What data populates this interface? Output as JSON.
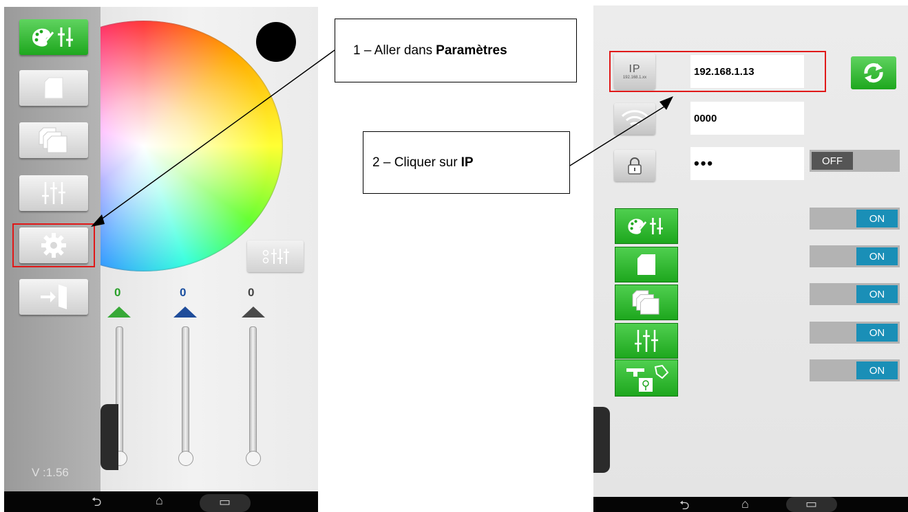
{
  "left_screen": {
    "version": "V :1.56",
    "values": [
      "0",
      "0",
      "0"
    ],
    "value_colors": [
      "#2aa02a",
      "#1a4fa0",
      "#444444"
    ],
    "sidebar_icons": [
      "palette-sliders-icon",
      "single-page-icon",
      "multi-page-icon",
      "sliders-icon",
      "gear-icon",
      "exit-door-icon"
    ]
  },
  "right_screen": {
    "ip_button_caption": "IP",
    "ip_button_subcaption": "192.168.1.xx",
    "ip_value": "192.168.1.13",
    "wifi_value": "0000",
    "password_value": "•••",
    "lock_toggle": "OFF",
    "feature_toggles": [
      "ON",
      "ON",
      "ON",
      "ON",
      "ON"
    ]
  },
  "callouts": {
    "step1_prefix": "1 – Aller dans",
    "step1_bold": "Paramètres",
    "step2_prefix": "2 – Cliquer sur",
    "step2_bold": "IP"
  },
  "colors": {
    "accent_green": "#1ea71e",
    "toggle_on": "#1a8fb7",
    "highlight_red": "#e01818"
  }
}
